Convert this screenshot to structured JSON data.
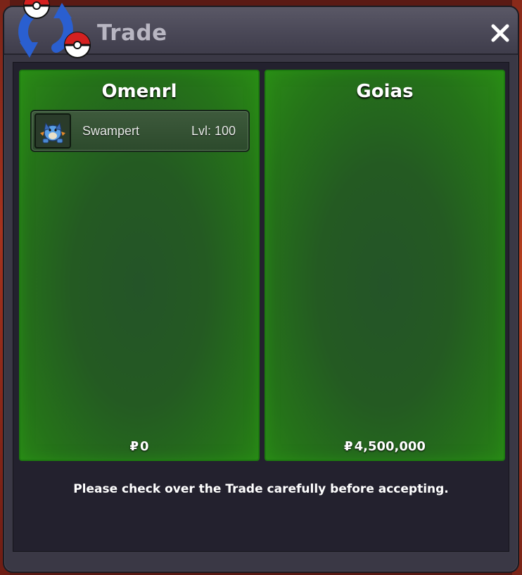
{
  "window": {
    "title": "Trade",
    "close_icon": "close-icon"
  },
  "colors": {
    "panel_green": "#257319",
    "content_bg": "#23212e",
    "window_bg": "#3a3845"
  },
  "left_panel": {
    "player_name": "Omenrl",
    "items": [
      {
        "icon": "swampert-sprite-icon",
        "name": "Swampert",
        "level": "Lvl: 100"
      }
    ],
    "currency_symbol": "₽",
    "money": "0"
  },
  "right_panel": {
    "player_name": "Goias",
    "items": [],
    "currency_symbol": "₽",
    "money": "4,500,000"
  },
  "notice": "Please check over the Trade carefully before accepting."
}
